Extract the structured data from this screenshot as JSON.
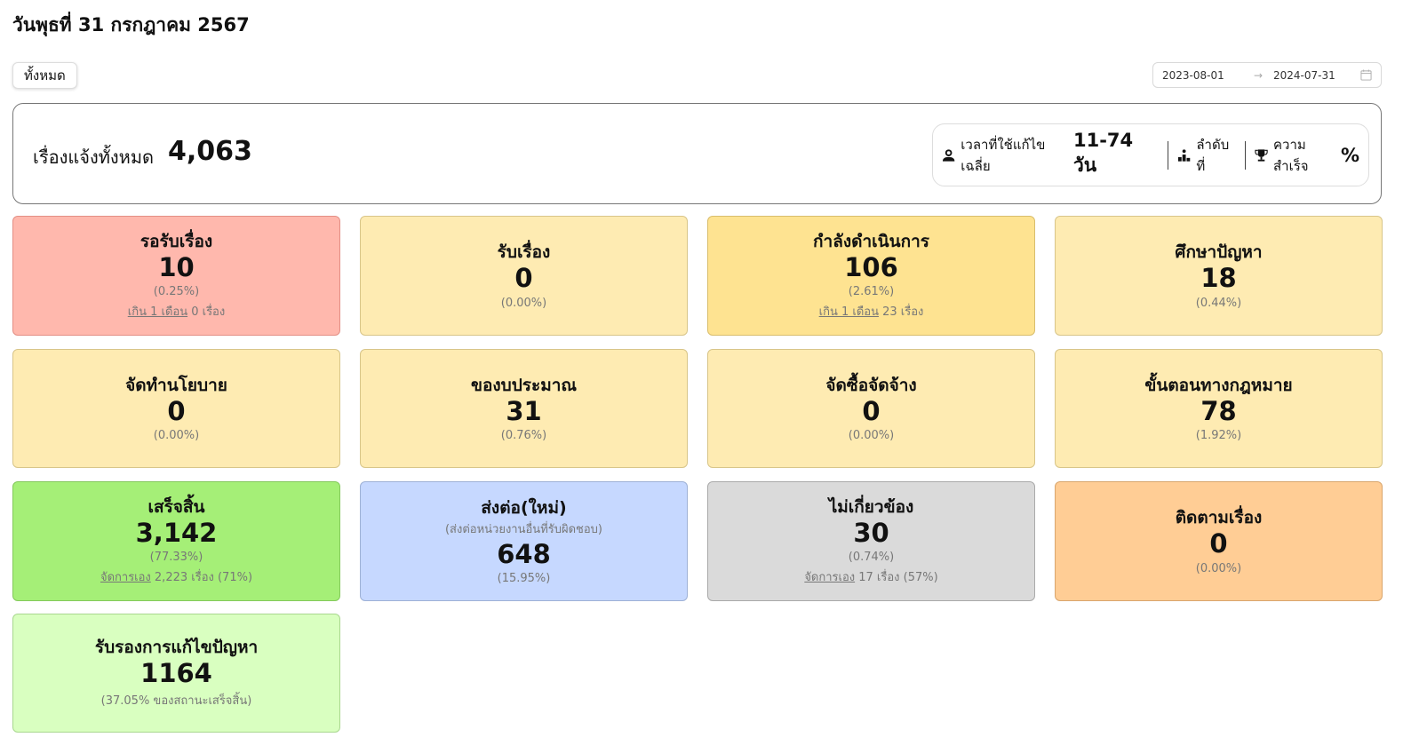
{
  "header": {
    "date": "วันพุธที่ 31 กรกฎาคม 2567",
    "filter_label": "ทั้งหมด",
    "date_from": "2023-08-01",
    "date_to": "2024-07-31",
    "arrow": "→"
  },
  "summary": {
    "label": "เรื่องแจ้งทั้งหมด",
    "total": "4,063",
    "avg_time_label": "เวลาที่ใช้แก้ไขเฉลี่ย",
    "avg_time_value": "11-74 วัน",
    "rank_label": "ลำดับที่",
    "success_label": "ความสำเร็จ",
    "success_value": "%"
  },
  "cards": [
    {
      "title": "รอรับเรื่อง",
      "value": "10",
      "pct": "(0.25%)",
      "note_link": "เกิน 1 เดือน",
      "note_rest": " 0 เรื่อง",
      "color": "#ffb8ad"
    },
    {
      "title": "รับเรื่อง",
      "value": "0",
      "pct": "(0.00%)",
      "color": "#feebb2"
    },
    {
      "title": "กำลังดำเนินการ",
      "value": "106",
      "pct": "(2.61%)",
      "note_link": "เกิน 1 เดือน",
      "note_rest": " 23 เรื่อง",
      "color": "#fee391"
    },
    {
      "title": "ศึกษาปัญหา",
      "value": "18",
      "pct": "(0.44%)",
      "color": "#feebb2"
    },
    {
      "title": "จัดทำนโยบาย",
      "value": "0",
      "pct": "(0.00%)",
      "color": "#feebb2"
    },
    {
      "title": "ของบประมาณ",
      "value": "31",
      "pct": "(0.76%)",
      "color": "#feebb2"
    },
    {
      "title": "จัดซื้อจัดจ้าง",
      "value": "0",
      "pct": "(0.00%)",
      "color": "#feebb2"
    },
    {
      "title": "ขั้นตอนทางกฎหมาย",
      "value": "78",
      "pct": "(1.92%)",
      "color": "#feebb2"
    },
    {
      "title": "เสร็จสิ้น",
      "value": "3,142",
      "pct": "(77.33%)",
      "note_link": "จัดการเอง",
      "note_rest": " 2,223 เรื่อง (71%)",
      "color": "#a5ef77"
    },
    {
      "title": "ส่งต่อ(ใหม่)",
      "sub": "(ส่งต่อหน่วยงานอื่นที่รับผิดชอบ)",
      "value": "648",
      "pct": "(15.95%)",
      "color": "#c6d8ff"
    },
    {
      "title": "ไม่เกี่ยวข้อง",
      "value": "30",
      "pct": "(0.74%)",
      "note_link": "จัดการเอง",
      "note_rest": " 17 เรื่อง (57%)",
      "color": "#dadada"
    },
    {
      "title": "ติดตามเรื่อง",
      "value": "0",
      "pct": "(0.00%)",
      "color": "#ffcd95"
    },
    {
      "title": "รับรองการแก้ไขปัญหา",
      "value": "1164",
      "pct": "(37.05% ของสถานะเสร็จสิ้น)",
      "color": "#d9ffc0"
    }
  ]
}
